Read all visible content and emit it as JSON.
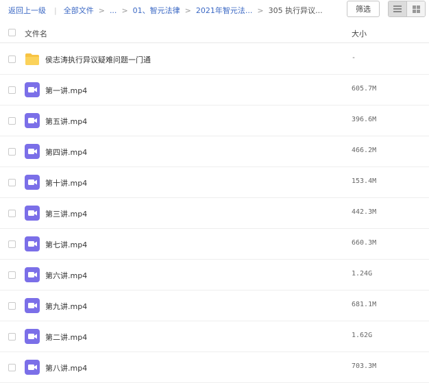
{
  "breadcrumb": {
    "back": "返回上一级",
    "root": "全部文件",
    "sep": ">",
    "ellipsis": "...",
    "level1": "01、智元法律",
    "level2": "2021年智元法...",
    "current": "305 执行异议..."
  },
  "toolbar": {
    "filter_label": "筛选",
    "view_mode": "list"
  },
  "columns": {
    "name": "文件名",
    "size": "大小"
  },
  "files": [
    {
      "name": "侯志涛执行异议疑难问题一门通",
      "size": "-",
      "type": "folder"
    },
    {
      "name": "第一讲.mp4",
      "size": "605.7M",
      "type": "video"
    },
    {
      "name": "第五讲.mp4",
      "size": "396.6M",
      "type": "video"
    },
    {
      "name": "第四讲.mp4",
      "size": "466.2M",
      "type": "video"
    },
    {
      "name": "第十讲.mp4",
      "size": "153.4M",
      "type": "video"
    },
    {
      "name": "第三讲.mp4",
      "size": "442.3M",
      "type": "video"
    },
    {
      "name": "第七讲.mp4",
      "size": "660.3M",
      "type": "video"
    },
    {
      "name": "第六讲.mp4",
      "size": "1.24G",
      "type": "video"
    },
    {
      "name": "第九讲.mp4",
      "size": "681.1M",
      "type": "video"
    },
    {
      "name": "第二讲.mp4",
      "size": "1.62G",
      "type": "video"
    },
    {
      "name": "第八讲.mp4",
      "size": "703.3M",
      "type": "video"
    }
  ],
  "colors": {
    "link": "#3b68c4",
    "folder": "#f7c343",
    "video": "#7b6fe8"
  }
}
